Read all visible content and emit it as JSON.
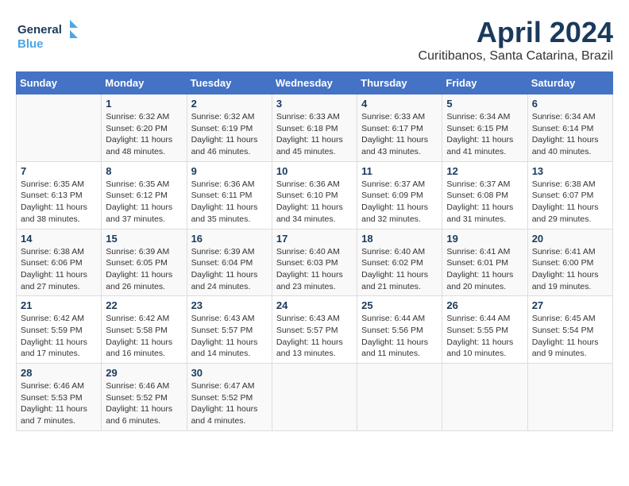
{
  "header": {
    "logo_line1": "General",
    "logo_line2": "Blue",
    "month": "April 2024",
    "location": "Curitibanos, Santa Catarina, Brazil"
  },
  "days_of_week": [
    "Sunday",
    "Monday",
    "Tuesday",
    "Wednesday",
    "Thursday",
    "Friday",
    "Saturday"
  ],
  "weeks": [
    [
      {
        "day": "",
        "sunrise": "",
        "sunset": "",
        "daylight": ""
      },
      {
        "day": "1",
        "sunrise": "Sunrise: 6:32 AM",
        "sunset": "Sunset: 6:20 PM",
        "daylight": "Daylight: 11 hours and 48 minutes."
      },
      {
        "day": "2",
        "sunrise": "Sunrise: 6:32 AM",
        "sunset": "Sunset: 6:19 PM",
        "daylight": "Daylight: 11 hours and 46 minutes."
      },
      {
        "day": "3",
        "sunrise": "Sunrise: 6:33 AM",
        "sunset": "Sunset: 6:18 PM",
        "daylight": "Daylight: 11 hours and 45 minutes."
      },
      {
        "day": "4",
        "sunrise": "Sunrise: 6:33 AM",
        "sunset": "Sunset: 6:17 PM",
        "daylight": "Daylight: 11 hours and 43 minutes."
      },
      {
        "day": "5",
        "sunrise": "Sunrise: 6:34 AM",
        "sunset": "Sunset: 6:15 PM",
        "daylight": "Daylight: 11 hours and 41 minutes."
      },
      {
        "day": "6",
        "sunrise": "Sunrise: 6:34 AM",
        "sunset": "Sunset: 6:14 PM",
        "daylight": "Daylight: 11 hours and 40 minutes."
      }
    ],
    [
      {
        "day": "7",
        "sunrise": "Sunrise: 6:35 AM",
        "sunset": "Sunset: 6:13 PM",
        "daylight": "Daylight: 11 hours and 38 minutes."
      },
      {
        "day": "8",
        "sunrise": "Sunrise: 6:35 AM",
        "sunset": "Sunset: 6:12 PM",
        "daylight": "Daylight: 11 hours and 37 minutes."
      },
      {
        "day": "9",
        "sunrise": "Sunrise: 6:36 AM",
        "sunset": "Sunset: 6:11 PM",
        "daylight": "Daylight: 11 hours and 35 minutes."
      },
      {
        "day": "10",
        "sunrise": "Sunrise: 6:36 AM",
        "sunset": "Sunset: 6:10 PM",
        "daylight": "Daylight: 11 hours and 34 minutes."
      },
      {
        "day": "11",
        "sunrise": "Sunrise: 6:37 AM",
        "sunset": "Sunset: 6:09 PM",
        "daylight": "Daylight: 11 hours and 32 minutes."
      },
      {
        "day": "12",
        "sunrise": "Sunrise: 6:37 AM",
        "sunset": "Sunset: 6:08 PM",
        "daylight": "Daylight: 11 hours and 31 minutes."
      },
      {
        "day": "13",
        "sunrise": "Sunrise: 6:38 AM",
        "sunset": "Sunset: 6:07 PM",
        "daylight": "Daylight: 11 hours and 29 minutes."
      }
    ],
    [
      {
        "day": "14",
        "sunrise": "Sunrise: 6:38 AM",
        "sunset": "Sunset: 6:06 PM",
        "daylight": "Daylight: 11 hours and 27 minutes."
      },
      {
        "day": "15",
        "sunrise": "Sunrise: 6:39 AM",
        "sunset": "Sunset: 6:05 PM",
        "daylight": "Daylight: 11 hours and 26 minutes."
      },
      {
        "day": "16",
        "sunrise": "Sunrise: 6:39 AM",
        "sunset": "Sunset: 6:04 PM",
        "daylight": "Daylight: 11 hours and 24 minutes."
      },
      {
        "day": "17",
        "sunrise": "Sunrise: 6:40 AM",
        "sunset": "Sunset: 6:03 PM",
        "daylight": "Daylight: 11 hours and 23 minutes."
      },
      {
        "day": "18",
        "sunrise": "Sunrise: 6:40 AM",
        "sunset": "Sunset: 6:02 PM",
        "daylight": "Daylight: 11 hours and 21 minutes."
      },
      {
        "day": "19",
        "sunrise": "Sunrise: 6:41 AM",
        "sunset": "Sunset: 6:01 PM",
        "daylight": "Daylight: 11 hours and 20 minutes."
      },
      {
        "day": "20",
        "sunrise": "Sunrise: 6:41 AM",
        "sunset": "Sunset: 6:00 PM",
        "daylight": "Daylight: 11 hours and 19 minutes."
      }
    ],
    [
      {
        "day": "21",
        "sunrise": "Sunrise: 6:42 AM",
        "sunset": "Sunset: 5:59 PM",
        "daylight": "Daylight: 11 hours and 17 minutes."
      },
      {
        "day": "22",
        "sunrise": "Sunrise: 6:42 AM",
        "sunset": "Sunset: 5:58 PM",
        "daylight": "Daylight: 11 hours and 16 minutes."
      },
      {
        "day": "23",
        "sunrise": "Sunrise: 6:43 AM",
        "sunset": "Sunset: 5:57 PM",
        "daylight": "Daylight: 11 hours and 14 minutes."
      },
      {
        "day": "24",
        "sunrise": "Sunrise: 6:43 AM",
        "sunset": "Sunset: 5:57 PM",
        "daylight": "Daylight: 11 hours and 13 minutes."
      },
      {
        "day": "25",
        "sunrise": "Sunrise: 6:44 AM",
        "sunset": "Sunset: 5:56 PM",
        "daylight": "Daylight: 11 hours and 11 minutes."
      },
      {
        "day": "26",
        "sunrise": "Sunrise: 6:44 AM",
        "sunset": "Sunset: 5:55 PM",
        "daylight": "Daylight: 11 hours and 10 minutes."
      },
      {
        "day": "27",
        "sunrise": "Sunrise: 6:45 AM",
        "sunset": "Sunset: 5:54 PM",
        "daylight": "Daylight: 11 hours and 9 minutes."
      }
    ],
    [
      {
        "day": "28",
        "sunrise": "Sunrise: 6:46 AM",
        "sunset": "Sunset: 5:53 PM",
        "daylight": "Daylight: 11 hours and 7 minutes."
      },
      {
        "day": "29",
        "sunrise": "Sunrise: 6:46 AM",
        "sunset": "Sunset: 5:52 PM",
        "daylight": "Daylight: 11 hours and 6 minutes."
      },
      {
        "day": "30",
        "sunrise": "Sunrise: 6:47 AM",
        "sunset": "Sunset: 5:52 PM",
        "daylight": "Daylight: 11 hours and 4 minutes."
      },
      {
        "day": "",
        "sunrise": "",
        "sunset": "",
        "daylight": ""
      },
      {
        "day": "",
        "sunrise": "",
        "sunset": "",
        "daylight": ""
      },
      {
        "day": "",
        "sunrise": "",
        "sunset": "",
        "daylight": ""
      },
      {
        "day": "",
        "sunrise": "",
        "sunset": "",
        "daylight": ""
      }
    ]
  ]
}
